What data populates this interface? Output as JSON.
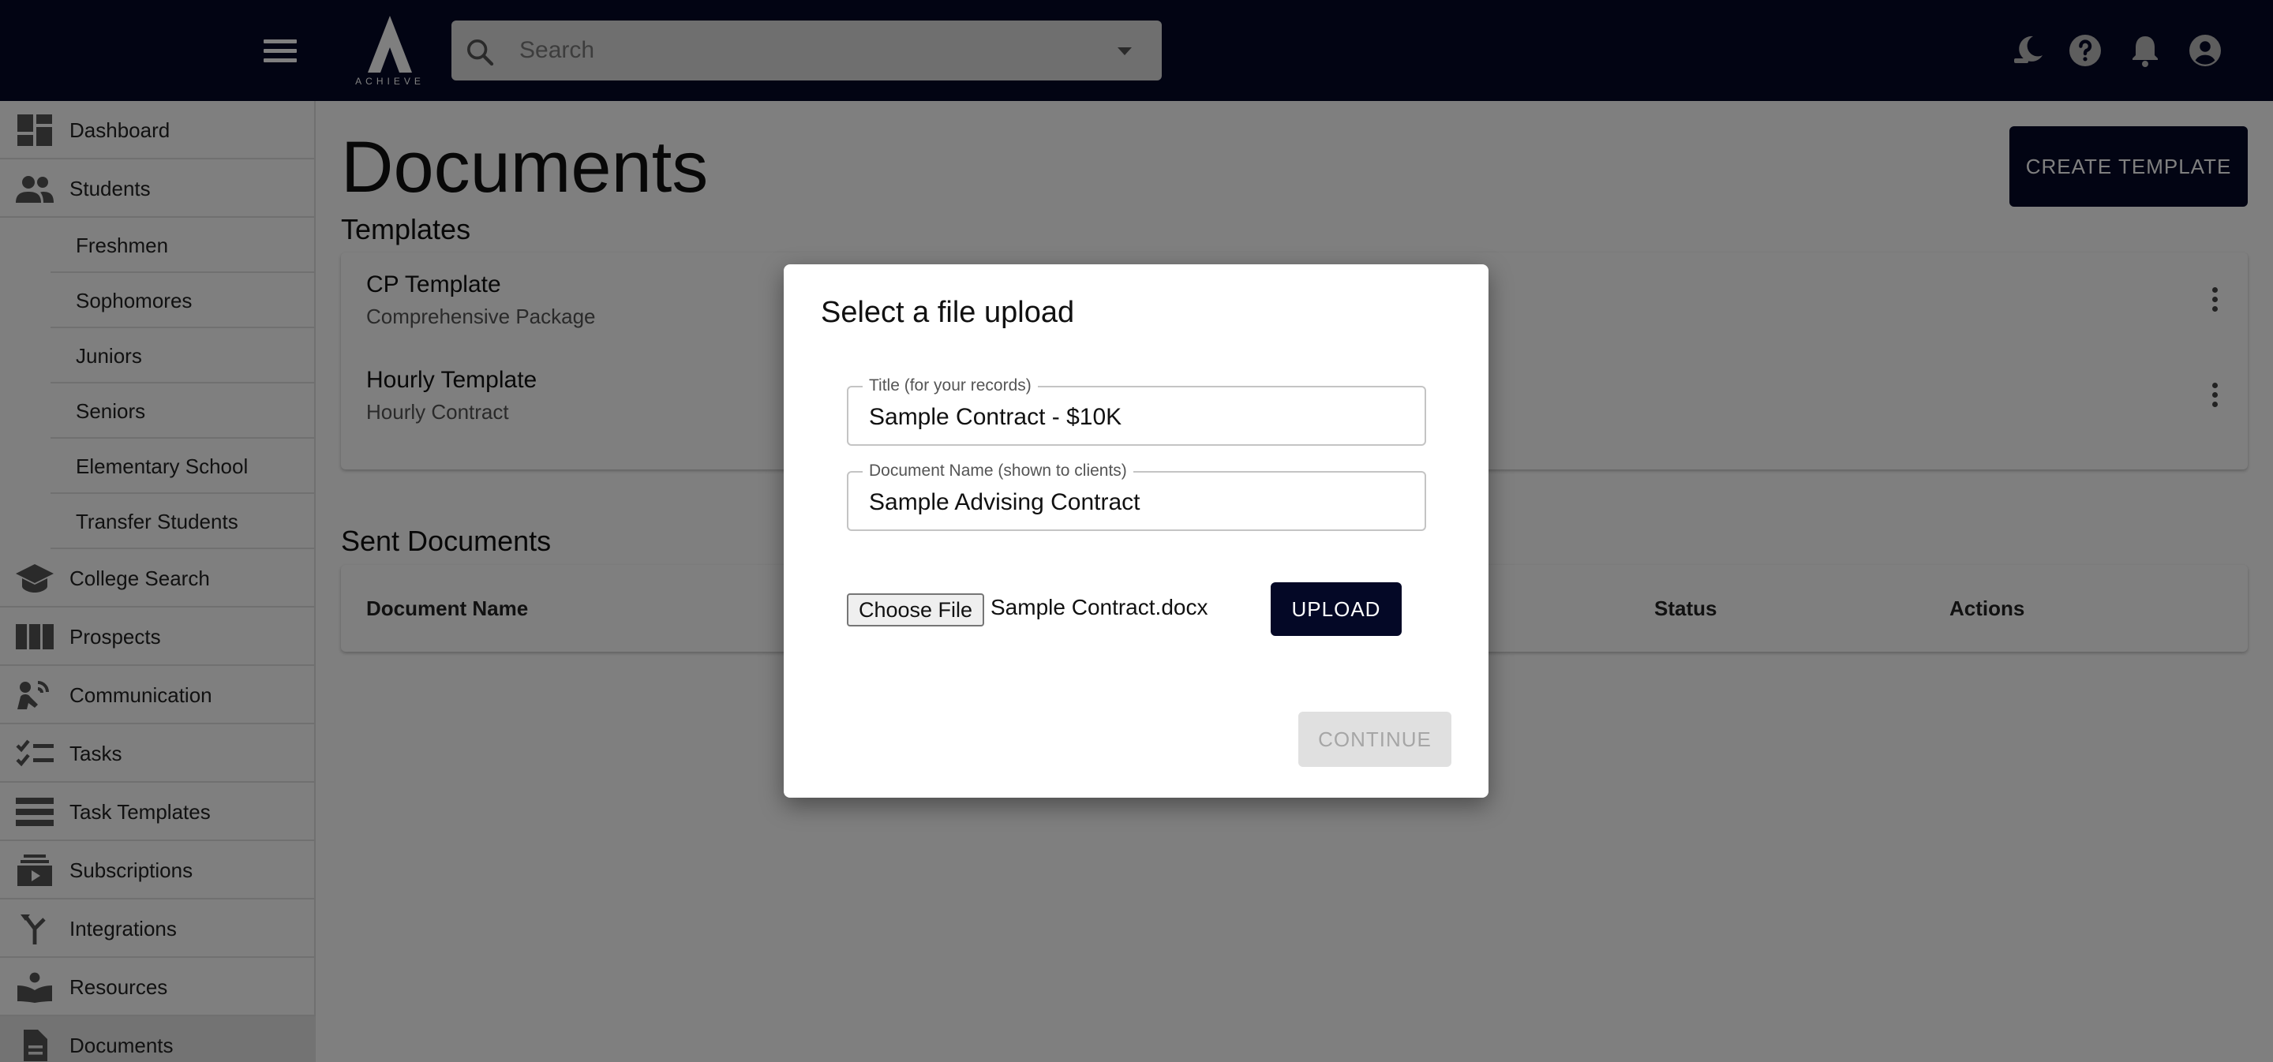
{
  "brand": {
    "logo_text": "ACHIEVE"
  },
  "search": {
    "placeholder": "Search"
  },
  "topbar": {
    "icons": [
      "theme-toggle-icon",
      "help-icon",
      "notifications-icon",
      "account-icon"
    ]
  },
  "sidebar": {
    "items": [
      {
        "label": "Dashboard",
        "icon": "dashboard-icon"
      },
      {
        "label": "Students",
        "icon": "people-icon"
      },
      {
        "label": "College Search",
        "icon": "school-icon"
      },
      {
        "label": "Prospects",
        "icon": "columns-icon"
      },
      {
        "label": "Communication",
        "icon": "communication-icon"
      },
      {
        "label": "Tasks",
        "icon": "checklist-icon"
      },
      {
        "label": "Task Templates",
        "icon": "list-icon"
      },
      {
        "label": "Subscriptions",
        "icon": "subscriptions-icon"
      },
      {
        "label": "Integrations",
        "icon": "merge-icon"
      },
      {
        "label": "Resources",
        "icon": "book-icon"
      },
      {
        "label": "Documents",
        "icon": "document-icon"
      }
    ],
    "student_groups": [
      "Freshmen",
      "Sophomores",
      "Juniors",
      "Seniors",
      "Elementary School",
      "Transfer Students"
    ]
  },
  "main": {
    "title": "Documents",
    "create_button": "CREATE TEMPLATE",
    "templates_heading": "Templates",
    "templates": [
      {
        "name": "CP Template",
        "description": "Comprehensive Package"
      },
      {
        "name": "Hourly Template",
        "description": "Hourly Contract"
      }
    ],
    "sent_heading": "Sent Documents",
    "sent_columns": [
      "Document Name",
      "Status",
      "Actions"
    ]
  },
  "dialog": {
    "title": "Select a file upload",
    "title_field": {
      "label": "Title (for your records)",
      "value": "Sample Contract - $10K"
    },
    "docname_field": {
      "label": "Document Name (shown to clients)",
      "value": "Sample Advising Contract"
    },
    "choose_file_label": "Choose File",
    "file_name": "Sample Contract.docx",
    "upload_label": "UPLOAD",
    "continue_label": "CONTINUE"
  },
  "colors": {
    "navy": "#040826",
    "overlay": "rgba(0,0,0,0.5)",
    "disabled": "#e0e0e0"
  }
}
